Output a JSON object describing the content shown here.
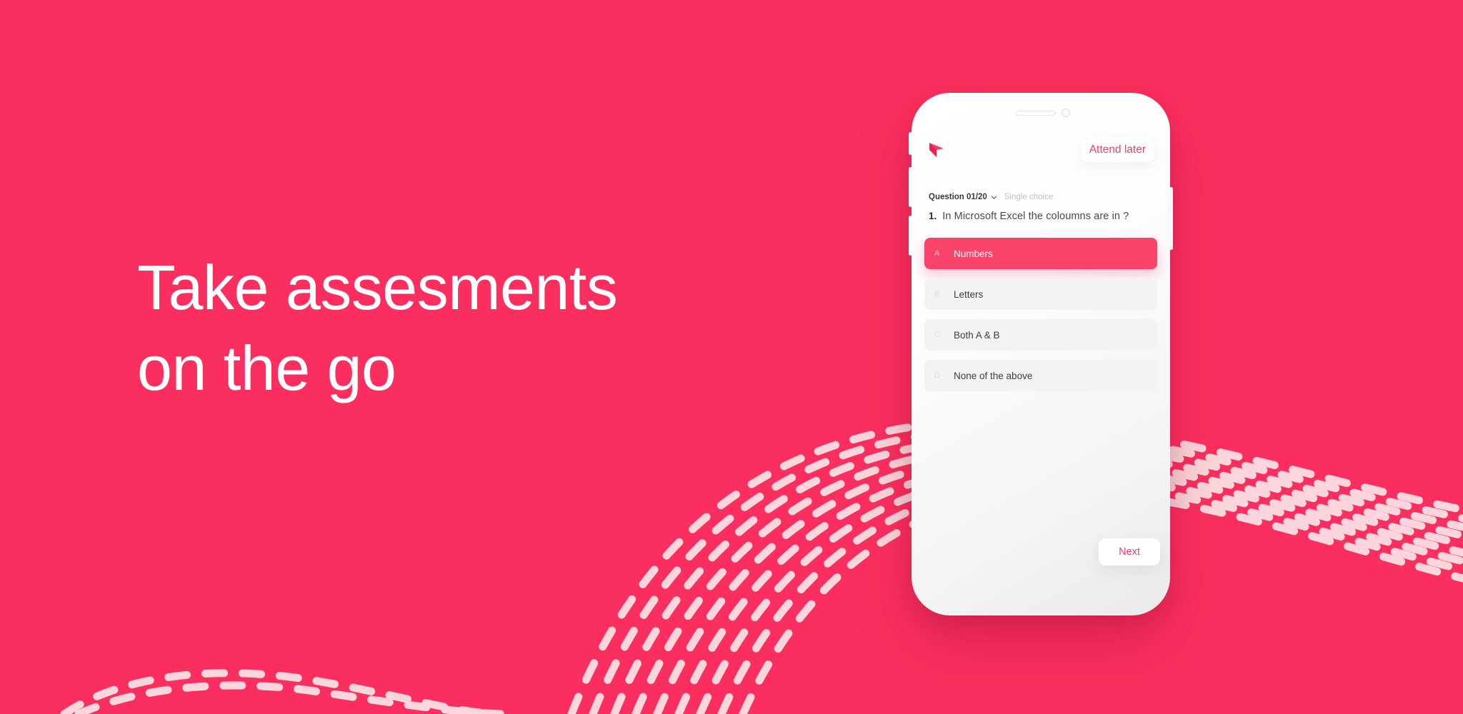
{
  "theme": {
    "background": "#FB2F5F",
    "accent": "#F43C67",
    "selected_option_bg": "#F9436A",
    "dash_color": "#FCD6DC",
    "option_bg": "#F3F3F3",
    "phone_body": "#FFFFFF"
  },
  "hero": {
    "headline": "Take assesments\non the go"
  },
  "phone": {
    "header": {
      "logo_icon": "flag-icon",
      "attend_later_label": "Attend later"
    },
    "meta": {
      "question_counter": "Question 01/20",
      "chevron_icon": "chevron-down-icon",
      "question_type": "Single choice"
    },
    "question": {
      "number": "1.",
      "text": "In Microsoft Excel the coloumns are in ?"
    },
    "options": [
      {
        "letter": "A",
        "label": "Numbers",
        "selected": true
      },
      {
        "letter": "B",
        "label": "Letters",
        "selected": false
      },
      {
        "letter": "C",
        "label": "Both A & B",
        "selected": false
      },
      {
        "letter": "D",
        "label": "None of the above",
        "selected": false
      }
    ],
    "footer": {
      "next_label": "Next"
    }
  },
  "decoration": {
    "wave_pattern": "dashed-wave-pattern"
  }
}
